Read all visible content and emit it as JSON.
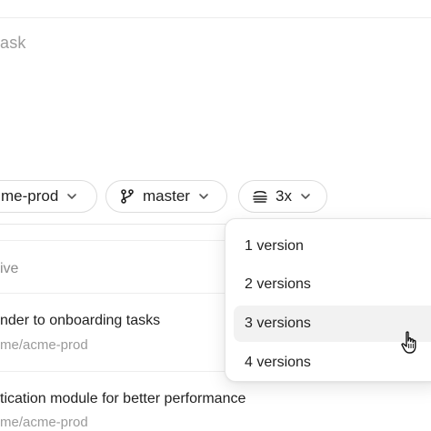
{
  "prompt": {
    "placeholder_visible": "ask"
  },
  "chips": {
    "repo_label": "me-prod",
    "branch_label": "master",
    "versions_label": "3x"
  },
  "tasks": {
    "header_partial": "ive",
    "items": [
      {
        "title": "nder to onboarding tasks",
        "meta": "me/acme-prod"
      },
      {
        "title": "tication module for better performance",
        "meta": "me/acme-prod"
      }
    ]
  },
  "versions_menu": {
    "options": [
      "1 version",
      "2 versions",
      "3 versions",
      "4 versions"
    ],
    "highlighted_index": 2
  },
  "icons": {
    "chevron": "chevron-down-icon",
    "branch": "git-branch-icon",
    "versions": "stack-icon",
    "cursor": "hand-pointer-icon"
  },
  "colors": {
    "border": "#dcdcdc",
    "placeholder": "#9b9b9b",
    "muted": "#9a9a9a",
    "highlight": "#f2f2f2"
  }
}
